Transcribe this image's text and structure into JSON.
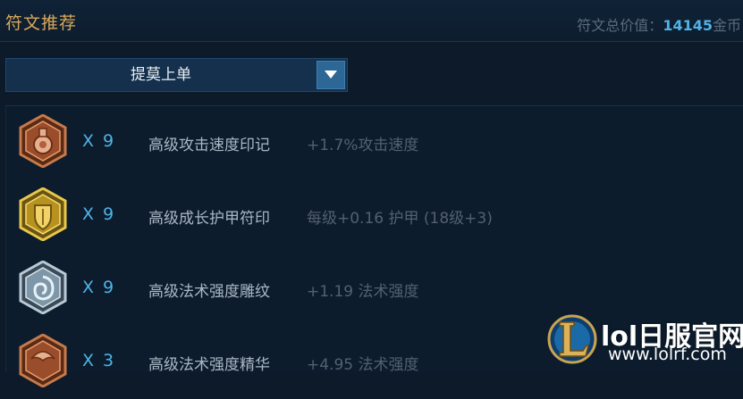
{
  "header": {
    "title": "符文推荐",
    "value_label": "符文总价值：",
    "value_number": "14145",
    "value_unit": "金币"
  },
  "dropdown": {
    "selected": "提莫上单",
    "arrow_icon": "triangle-down-icon"
  },
  "runes": [
    {
      "icon": "attack-speed-mark-icon",
      "color": "#b0603a",
      "count": "X 9",
      "name": "高级攻击速度印记",
      "stat": "+1.7%攻击速度"
    },
    {
      "icon": "armor-seal-icon",
      "color": "#d7b43a",
      "count": "X 9",
      "name": "高级成长护甲符印",
      "stat": "每级+0.16 护甲 (18级+3)"
    },
    {
      "icon": "ability-power-glyph-icon",
      "color": "#8ea7b8",
      "count": "X 9",
      "name": "高级法术强度雕纹",
      "stat": "+1.19 法术强度"
    },
    {
      "icon": "ability-power-quintessence-icon",
      "color": "#b0603a",
      "count": "X 3",
      "name": "高级法术强度精华",
      "stat": "+4.95 法术强度"
    }
  ],
  "watermark": {
    "title": "lol日服官网",
    "url": "www.lolrf.com"
  }
}
